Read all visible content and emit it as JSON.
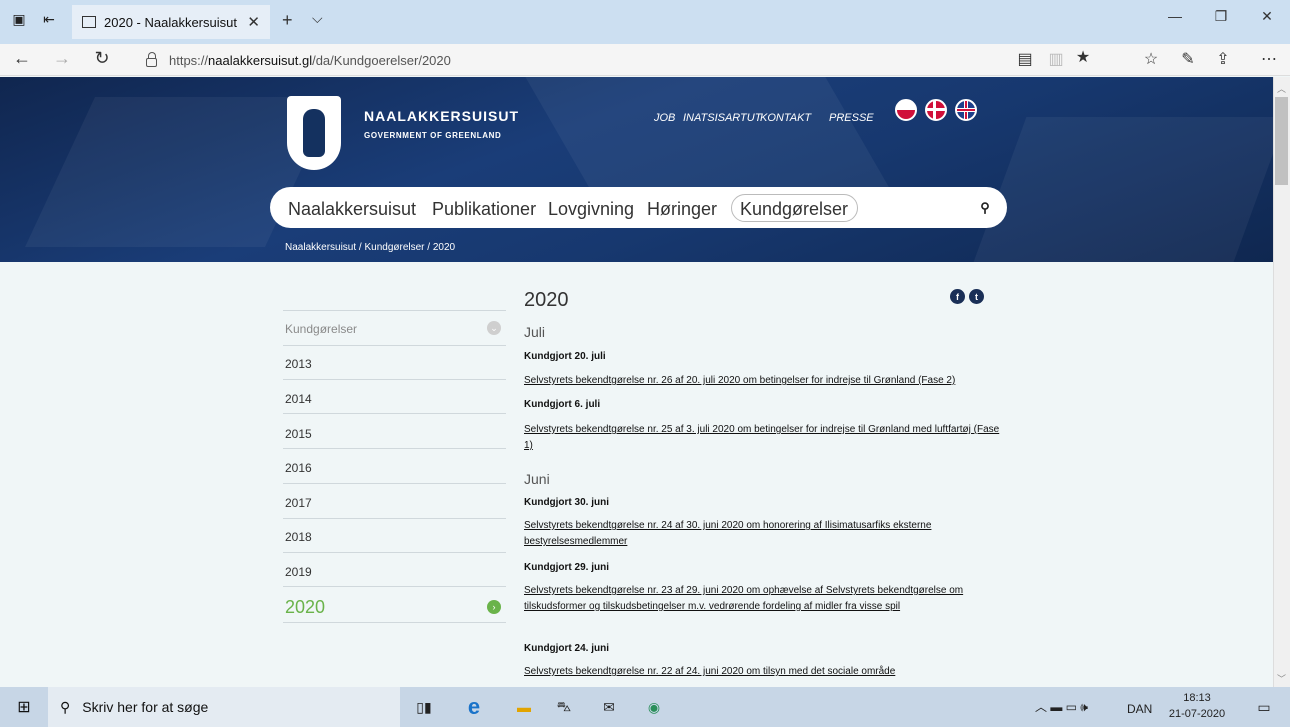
{
  "browser": {
    "tab_title": "2020 - Naalakkersuisut",
    "url_prefix": "https://",
    "url_host": "naalakkersuisut.gl",
    "url_path": "/da/Kundgoerelser/2020"
  },
  "header": {
    "brand_name": "NAALAKKERSUISUT",
    "brand_sub": "GOVERNMENT OF GREENLAND",
    "top_links": [
      "JOB",
      "INATSISARTUT",
      "KONTAKT",
      "PRESSE"
    ],
    "nav": [
      "Naalakkersuisut",
      "Publikationer",
      "Lovgivning",
      "Høringer",
      "Kundgørelser"
    ],
    "breadcrumb": "Naalakkersuisut / Kundgørelser / 2020"
  },
  "sidebar": {
    "heading": "Kundgørelser",
    "years": [
      "2013",
      "2014",
      "2015",
      "2016",
      "2017",
      "2018",
      "2019"
    ],
    "current": "2020"
  },
  "main": {
    "title": "2020",
    "month_juli": "Juli",
    "month_juni": "Juni",
    "entries": [
      {
        "date": "Kundgjort 20. juli",
        "text": "Selvstyrets bekendtgørelse nr. 26 af 20. juli 2020 om betingelser for indrejse til Grønland (Fase 2)"
      },
      {
        "date": "Kundgjort 6. juli",
        "text": "Selvstyrets bekendtgørelse nr. 25 af 3. juli 2020 om betingelser for indrejse til Grønland med luftfartøj (Fase 1)"
      },
      {
        "date": "Kundgjort 30. juni",
        "text": "Selvstyrets bekendtgørelse nr. 24 af 30. juni 2020 om honorering af Ilisimatusarfiks eksterne bestyrelsesmedlemmer"
      },
      {
        "date": "Kundgjort 29. juni",
        "text": "Selvstyrets bekendtgørelse nr. 23 af 29. juni 2020 om ophævelse af Selvstyrets bekendtgørelse om tilskudsformer og tilskudsbetingelser m.v. vedrørende fordeling af midler fra visse spil"
      },
      {
        "date": "Kundgjort 24. juni",
        "text": "Selvstyrets bekendtgørelse nr. 22 af 24. juni 2020 om tilsyn med det sociale område"
      }
    ]
  },
  "taskbar": {
    "search_placeholder": "Skriv her for at søge",
    "lang": "DAN",
    "time": "18:13",
    "date": "21-07-2020"
  }
}
